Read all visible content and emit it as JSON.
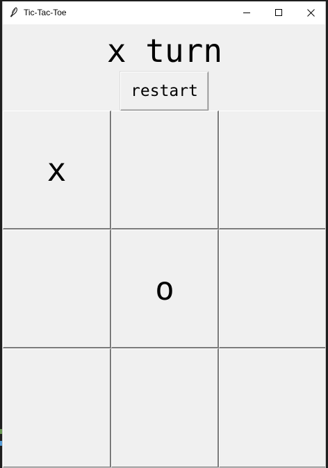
{
  "window": {
    "title": "Tic-Tac-Toe",
    "icon": "feather-icon",
    "controls": [
      "minimize-icon",
      "maximize-icon",
      "close-icon"
    ]
  },
  "game": {
    "status": "x turn",
    "restart_label": "restart",
    "board": [
      [
        "x",
        "",
        ""
      ],
      [
        "",
        "o",
        ""
      ],
      [
        "",
        "",
        ""
      ]
    ]
  }
}
